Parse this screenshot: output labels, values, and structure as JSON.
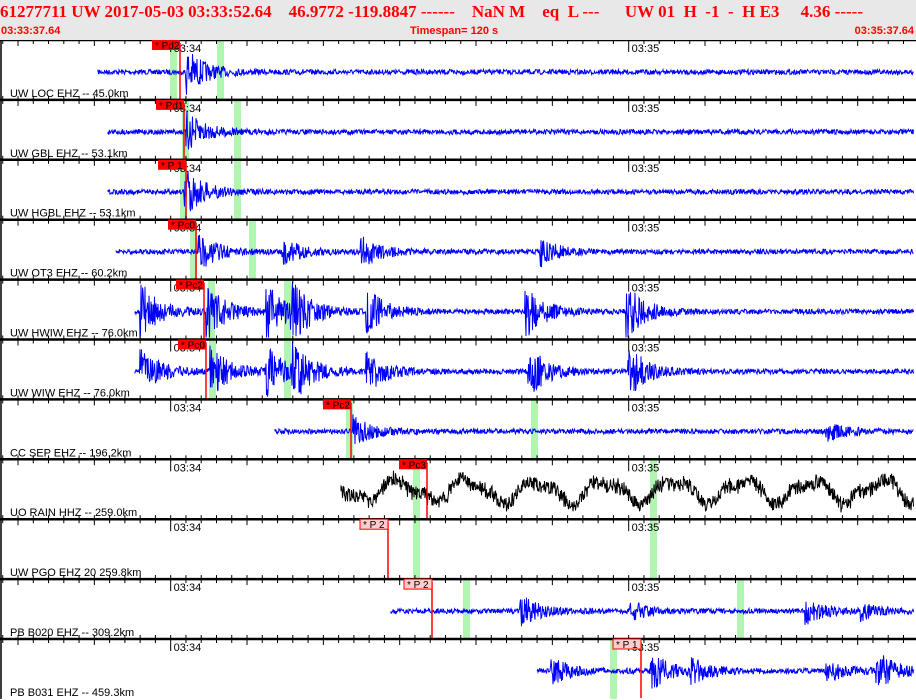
{
  "header": {
    "title": "61277711 UW 2017-05-03 03:33:52.64    46.9772 -119.8847 ------    NaN M    eq  L ---      UW 01  H  -1  -  H E3     4.36 -----",
    "start_time": "03:33:37.64",
    "timespan": "Timespan= 120 s",
    "end_time": "03:35:37.64"
  },
  "time_labels": [
    "03:34",
    "03:35"
  ],
  "colors": {
    "trace": "#0000ff",
    "trace_alt": "#000000",
    "pick": "#ff0000",
    "pick_pale": "#ffcccc",
    "window": "#b0f5b0"
  },
  "channels": [
    {
      "label": "UW LOC EHZ -- 45.0km",
      "pick": "* Pd2",
      "pale": false
    },
    {
      "label": "UW GBL EHZ -- 53.1km",
      "pick": "* Pd1",
      "pale": false
    },
    {
      "label": "UW HGBL EHZ -- 53.1km",
      "pick": "* P 1",
      "pale": false
    },
    {
      "label": "UW OT3 EHZ -- 60.2km",
      "pick": "* Pc0",
      "pale": false
    },
    {
      "label": "UW HWIW EHZ -- 76.0km",
      "pick": "* Pc2",
      "pale": false
    },
    {
      "label": "UW WIW EHZ -- 76.0km",
      "pick": "* Pc0",
      "pale": false
    },
    {
      "label": "CC SEP EHZ -- 196.2km",
      "pick": "* Pc2",
      "pale": false
    },
    {
      "label": "UO RAIN HHZ -- 259.0km",
      "pick": "* Pc3",
      "pale": false
    },
    {
      "label": "UW PGO EHZ 20 259.8km",
      "pick": "* P 2",
      "pale": true
    },
    {
      "label": "PB B020 EHZ -- 309.2km",
      "pick": "* P 2",
      "pale": true
    },
    {
      "label": "PB B031 EHZ -- 459.3km",
      "pick": "* P 1",
      "pale": true
    }
  ]
}
